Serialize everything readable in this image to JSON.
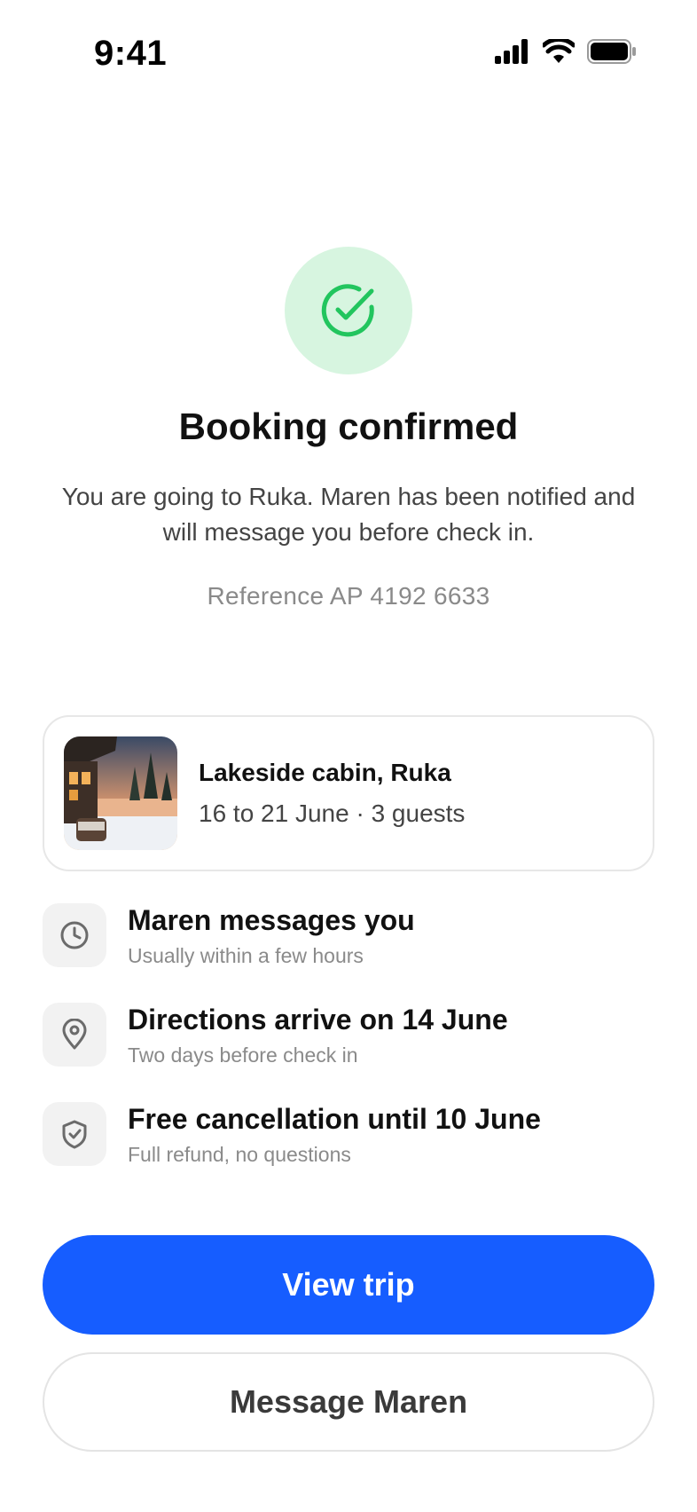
{
  "status_bar": {
    "time": "9:41"
  },
  "confirmation": {
    "title": "Booking confirmed",
    "subtitle": "You are going to Ruka. Maren has been notified and will message you before check in.",
    "reference": "Reference AP 4192 6633",
    "accent_color": "#22c55e"
  },
  "listing": {
    "name": "Lakeside cabin, Ruka",
    "meta": "16 to 21 June · 3 guests"
  },
  "steps": [
    {
      "icon": "clock-icon",
      "title": "Maren messages you",
      "subtitle": "Usually within a few hours"
    },
    {
      "icon": "location-pin-icon",
      "title": "Directions arrive on 14 June",
      "subtitle": "Two days before check in"
    },
    {
      "icon": "shield-check-icon",
      "title": "Free cancellation until 10 June",
      "subtitle": "Full refund, no questions"
    }
  ],
  "actions": {
    "primary_label": "View trip",
    "primary_color": "#165dff",
    "secondary_label": "Message Maren"
  }
}
